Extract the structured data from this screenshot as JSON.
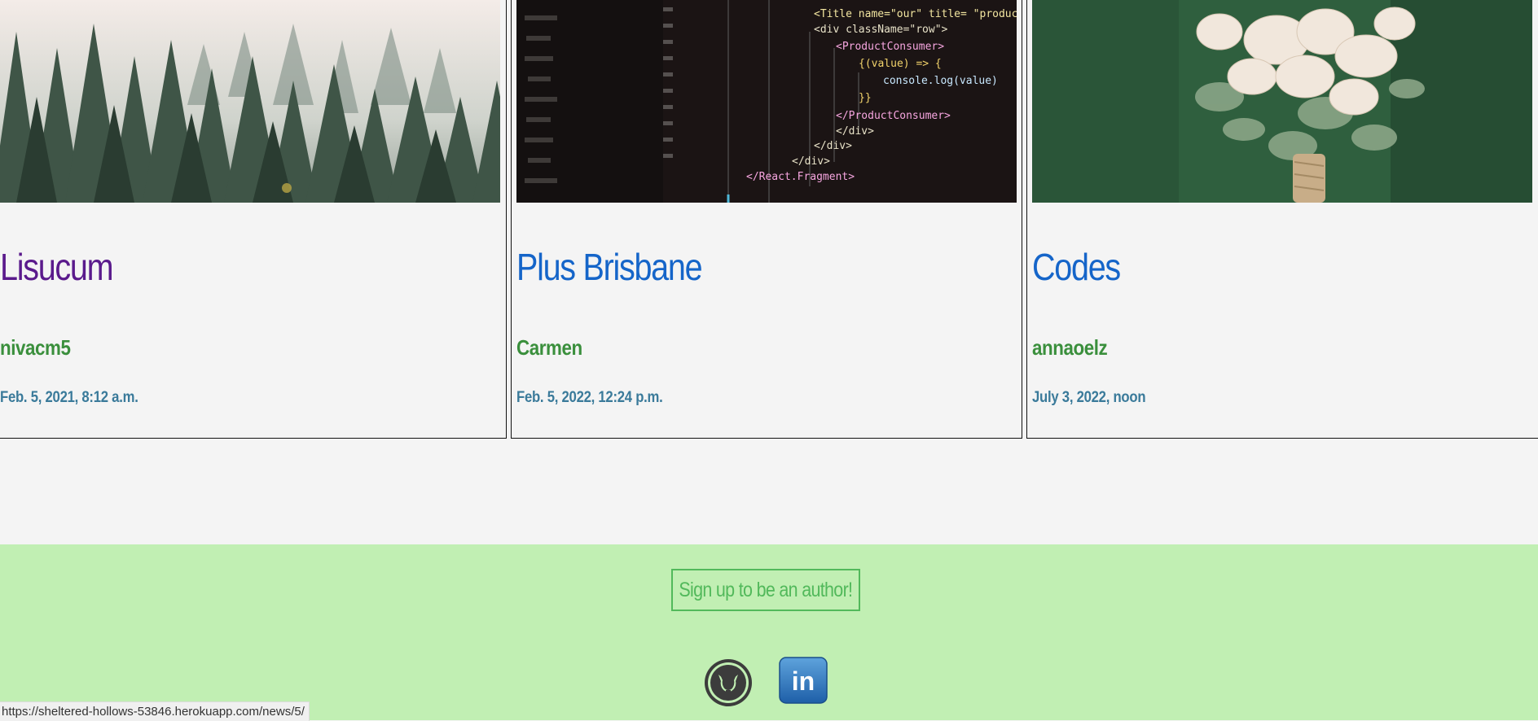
{
  "cards": [
    {
      "title": "Lisucum",
      "author": "nivacm5",
      "date": "Feb. 5, 2021, 8:12 a.m.",
      "image": "misty-forest-image"
    },
    {
      "title": "Plus Brisbane",
      "author": "Carmen",
      "date": "Feb. 5, 2022, 12:24 p.m.",
      "image": "code-editor-image"
    },
    {
      "title": "Codes",
      "author": "annaoelz",
      "date": "July 3, 2022, noon",
      "image": "flower-bouquet-image"
    }
  ],
  "code_lines": [
    "<Title name=\"our\" title= \"product",
    "<div className=\"row\">",
    "<ProductConsumer>",
    "{(value) => {",
    "console.log(value)",
    "}}",
    "</ProductConsumer>",
    "</div>",
    "</div>",
    "</div>",
    "</React.Fragment>"
  ],
  "footer": {
    "signup_label": "Sign up to be an author!",
    "social": [
      "github-icon",
      "linkedin-icon"
    ],
    "linkedin_text": "in"
  },
  "status_url": "https://sheltered-hollows-53846.herokuapp.com/news/5/",
  "colors": {
    "link": "#1565c9",
    "visited": "#5a1a8c",
    "author": "#3a8f3c",
    "date": "#3a7a9a",
    "footer_bg": "#c1efb3",
    "signup": "#52b95b"
  }
}
